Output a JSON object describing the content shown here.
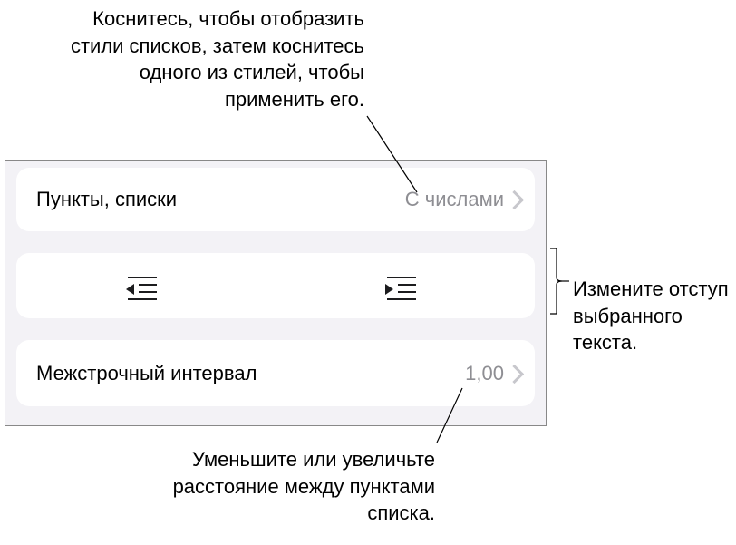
{
  "callouts": {
    "top": "Коснитесь, чтобы отобразить стили списков, затем коснитесь одного из стилей, чтобы применить его.",
    "right": "Измените отступ выбранного текста.",
    "bottom": "Уменьшите или увеличьте расстояние между пунктами списка."
  },
  "panel": {
    "bullets_lists": {
      "label": "Пункты, списки",
      "value": "С числами"
    },
    "line_spacing": {
      "label": "Межстрочный интервал",
      "value": "1,00"
    }
  }
}
